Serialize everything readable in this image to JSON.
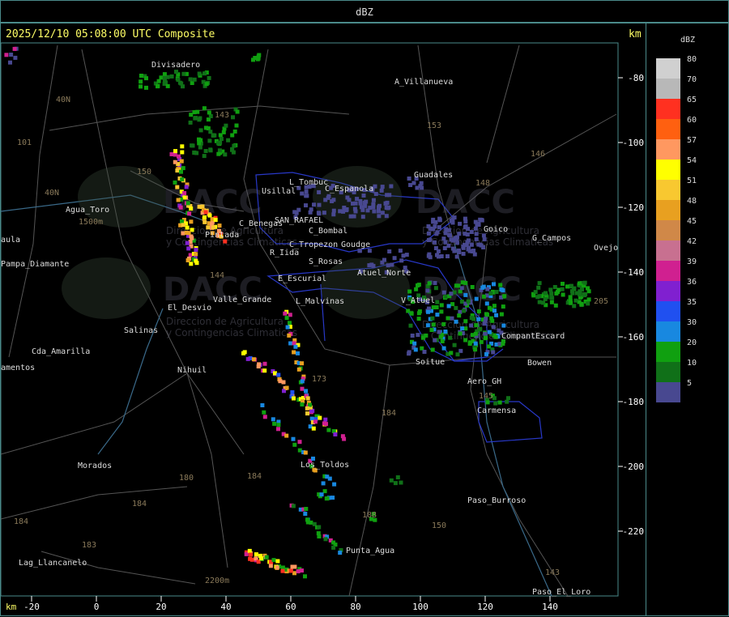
{
  "title": "dBZ",
  "header": {
    "timestamp": "2025/12/10 05:08:00 UTC Composite",
    "unit_top": "km",
    "unit_bottom": "km"
  },
  "axes": {
    "x_ticks": [
      "-20",
      "0",
      "20",
      "40",
      "60",
      "80",
      "100",
      "120",
      "140"
    ],
    "y_ticks": [
      "-80",
      "-100",
      "-120",
      "-140",
      "-160",
      "-180",
      "-200",
      "-220"
    ]
  },
  "legend": {
    "unit": "dBZ",
    "levels": [
      {
        "label": "80",
        "color": "#d0d0d0"
      },
      {
        "label": "70",
        "color": "#b8b8b8"
      },
      {
        "label": "65",
        "color": "#ff3020"
      },
      {
        "label": "60",
        "color": "#ff6010"
      },
      {
        "label": "57",
        "color": "#ff9860"
      },
      {
        "label": "54",
        "color": "#ffff00"
      },
      {
        "label": "51",
        "color": "#f8c830"
      },
      {
        "label": "48",
        "color": "#e8a020"
      },
      {
        "label": "45",
        "color": "#d08848"
      },
      {
        "label": "42",
        "color": "#c87090"
      },
      {
        "label": "39",
        "color": "#d02090"
      },
      {
        "label": "36",
        "color": "#8020d0"
      },
      {
        "label": "35",
        "color": "#2050f0"
      },
      {
        "label": "30",
        "color": "#1888e0"
      },
      {
        "label": "20",
        "color": "#10a010"
      },
      {
        "label": "10",
        "color": "#107018"
      },
      {
        "label": "5",
        "color": "#484890"
      }
    ]
  },
  "places": [
    {
      "name": "Divisadero",
      "x": 186,
      "y": 82
    },
    {
      "name": "A_Villanueva",
      "x": 486,
      "y": 103
    },
    {
      "name": "Guadales",
      "x": 510,
      "y": 218
    },
    {
      "name": "L_Tombuc",
      "x": 356,
      "y": 227
    },
    {
      "name": "C_Espanola",
      "x": 400,
      "y": 235
    },
    {
      "name": "Usillal",
      "x": 322,
      "y": 238
    },
    {
      "name": "Agua_Toro",
      "x": 80,
      "y": 261
    },
    {
      "name": "Goico",
      "x": 596,
      "y": 285
    },
    {
      "name": "G_Campos",
      "x": 656,
      "y": 296
    },
    {
      "name": "Ovejo",
      "x": 732,
      "y": 308
    },
    {
      "name": "aula",
      "x": 0,
      "y": 298
    },
    {
      "name": "Pampa_Diamante",
      "x": 0,
      "y": 328
    },
    {
      "name": "C_Benegas",
      "x": 294,
      "y": 278
    },
    {
      "name": "SAN_RAFAEL",
      "x": 338,
      "y": 274
    },
    {
      "name": "C_Bombal",
      "x": 380,
      "y": 287
    },
    {
      "name": "Pintada",
      "x": 252,
      "y": 292
    },
    {
      "name": "C_Tropezon",
      "x": 356,
      "y": 304
    },
    {
      "name": "Goudge",
      "x": 420,
      "y": 304
    },
    {
      "name": "R_Iida",
      "x": 332,
      "y": 314
    },
    {
      "name": "S_Rosas",
      "x": 380,
      "y": 325
    },
    {
      "name": "Atuel_Norte",
      "x": 440,
      "y": 339
    },
    {
      "name": "E_Escurial",
      "x": 342,
      "y": 346
    },
    {
      "name": "El_Desvio",
      "x": 206,
      "y": 382
    },
    {
      "name": "Valle_Grande",
      "x": 262,
      "y": 372
    },
    {
      "name": "L_Malvinas",
      "x": 364,
      "y": 374
    },
    {
      "name": "V_Atuel",
      "x": 494,
      "y": 373
    },
    {
      "name": "Salinas",
      "x": 152,
      "y": 410
    },
    {
      "name": "CompantEscard",
      "x": 618,
      "y": 417
    },
    {
      "name": "Cda_Amarilla",
      "x": 38,
      "y": 436
    },
    {
      "name": "amentos",
      "x": 0,
      "y": 456
    },
    {
      "name": "Nihuil",
      "x": 218,
      "y": 459
    },
    {
      "name": "Soitue",
      "x": 512,
      "y": 449
    },
    {
      "name": "Bowen",
      "x": 650,
      "y": 450
    },
    {
      "name": "Aero_GH",
      "x": 576,
      "y": 473
    },
    {
      "name": "Carmensa",
      "x": 588,
      "y": 509
    },
    {
      "name": "Morados",
      "x": 95,
      "y": 577
    },
    {
      "name": "Los_Toldos",
      "x": 370,
      "y": 576
    },
    {
      "name": "Paso_Burroso",
      "x": 576,
      "y": 620
    },
    {
      "name": "Punta_Agua",
      "x": 426,
      "y": 682
    },
    {
      "name": "Lag_Llancanelo",
      "x": 22,
      "y": 697
    },
    {
      "name": "Paso_El_Loro",
      "x": 656,
      "y": 733
    }
  ],
  "routes": [
    {
      "name": "40N",
      "x": 68,
      "y": 125
    },
    {
      "name": "101",
      "x": 20,
      "y": 178
    },
    {
      "name": "143",
      "x": 264,
      "y": 144
    },
    {
      "name": "153",
      "x": 526,
      "y": 157
    },
    {
      "name": "146",
      "x": 654,
      "y": 192
    },
    {
      "name": "150",
      "x": 168,
      "y": 214
    },
    {
      "name": "40N",
      "x": 54,
      "y": 240
    },
    {
      "name": "148",
      "x": 586,
      "y": 228
    },
    {
      "name": "144",
      "x": 258,
      "y": 342
    },
    {
      "name": "205",
      "x": 732,
      "y": 374
    },
    {
      "name": "173",
      "x": 384,
      "y": 470
    },
    {
      "name": "184",
      "x": 470,
      "y": 512
    },
    {
      "name": "180",
      "x": 220,
      "y": 592
    },
    {
      "name": "184",
      "x": 304,
      "y": 590
    },
    {
      "name": "184",
      "x": 162,
      "y": 624
    },
    {
      "name": "184",
      "x": 16,
      "y": 646
    },
    {
      "name": "150",
      "x": 532,
      "y": 651
    },
    {
      "name": "188",
      "x": 446,
      "y": 638
    },
    {
      "name": "183",
      "x": 100,
      "y": 675
    },
    {
      "name": "143",
      "x": 672,
      "y": 709
    },
    {
      "name": "2200m",
      "x": 252,
      "y": 719
    },
    {
      "name": "1500m",
      "x": 96,
      "y": 276
    },
    {
      "name": "145",
      "x": 590,
      "y": 491
    }
  ],
  "watermark": {
    "brand": "DACC",
    "line1": "Direccion de Agricultura",
    "line2": "y Contingencias Climaticas"
  }
}
